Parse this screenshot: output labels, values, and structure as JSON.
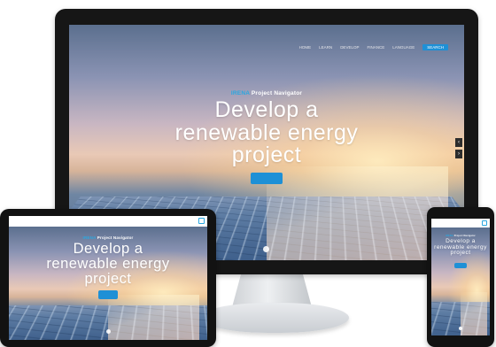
{
  "hero": {
    "brand_accent": "IRENA",
    "brand_rest": " Project Navigator",
    "headline_line1": "Develop a",
    "headline_line2": "renewable energy",
    "headline_line3": "project"
  },
  "desktop_nav": {
    "items": [
      "HOME",
      "LEARN",
      "DEVELOP",
      "FINANCE",
      "LANGUAGE"
    ],
    "search_label": "SEARCH"
  },
  "colors": {
    "accent": "#2aa7e0",
    "cta": "#1e90d6",
    "bezel": "#161616"
  }
}
